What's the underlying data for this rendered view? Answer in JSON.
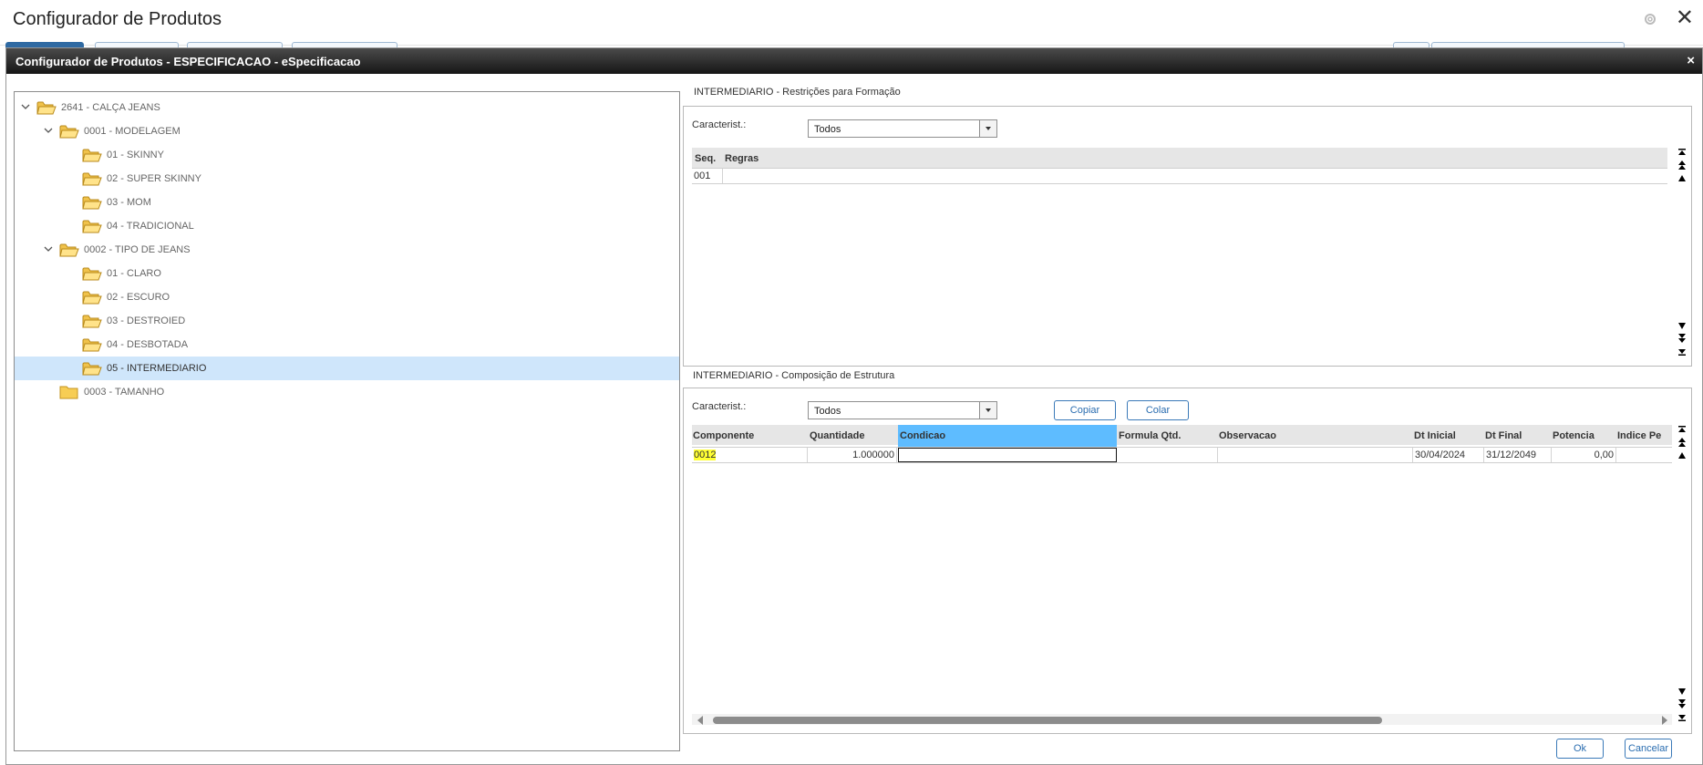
{
  "app": {
    "title": "Configurador de Produtos"
  },
  "modal": {
    "title": "Configurador de Produtos - ESPECIFICACAO - eSpecificacao",
    "close": "×"
  },
  "tree": {
    "nodes": [
      {
        "label": "2641 - CALÇA JEANS",
        "expanded": true,
        "level": 0
      },
      {
        "label": "0001 - MODELAGEM",
        "expanded": true,
        "level": 1
      },
      {
        "label": "01 - SKINNY",
        "level": 2
      },
      {
        "label": "02 - SUPER SKINNY",
        "level": 2
      },
      {
        "label": "03 - MOM",
        "level": 2
      },
      {
        "label": "04 - TRADICIONAL",
        "level": 2
      },
      {
        "label": "0002 - TIPO DE JEANS",
        "expanded": true,
        "level": 1
      },
      {
        "label": "01 - CLARO",
        "level": 2
      },
      {
        "label": "02 - ESCURO",
        "level": 2
      },
      {
        "label": "03 - DESTROIED",
        "level": 2
      },
      {
        "label": "04 - DESBOTADA",
        "level": 2
      },
      {
        "label": "05 - INTERMEDIARIO",
        "level": 2,
        "selected": true
      },
      {
        "label": "0003 - TAMANHO",
        "level": 1
      }
    ]
  },
  "restricoes": {
    "title": "INTERMEDIARIO - Restrições para Formação",
    "caracterist_label": "Caracterist.:",
    "caracterist_value": "Todos",
    "columns": [
      "Seq.",
      "Regras"
    ],
    "rows": [
      {
        "seq": "001",
        "regras": ""
      }
    ]
  },
  "composicao": {
    "title": "INTERMEDIARIO - Composição de Estrutura",
    "caracterist_label": "Caracterist.:",
    "caracterist_value": "Todos",
    "copy_label": "Copiar",
    "paste_label": "Colar",
    "columns": [
      "Componente",
      "Quantidade",
      "Condicao",
      "Formula Qtd.",
      "Observacao",
      "Dt Inicial",
      "Dt Final",
      "Potencia",
      "Indice Pe"
    ],
    "rows": [
      {
        "componente": "0012",
        "quantidade": "1.000000",
        "condicao": "",
        "formula": "",
        "observacao": "",
        "dt_inicial": "30/04/2024",
        "dt_final": "31/12/2049",
        "potencia": "0,00",
        "indice": ""
      }
    ]
  },
  "footer": {
    "ok_label": "Ok",
    "cancel_label": "Cancelar"
  },
  "colors": {
    "accent": "#2a6db0",
    "selected_row": "#cfe6fb",
    "active_header": "#5ebcff",
    "highlight": "#ffff33"
  }
}
